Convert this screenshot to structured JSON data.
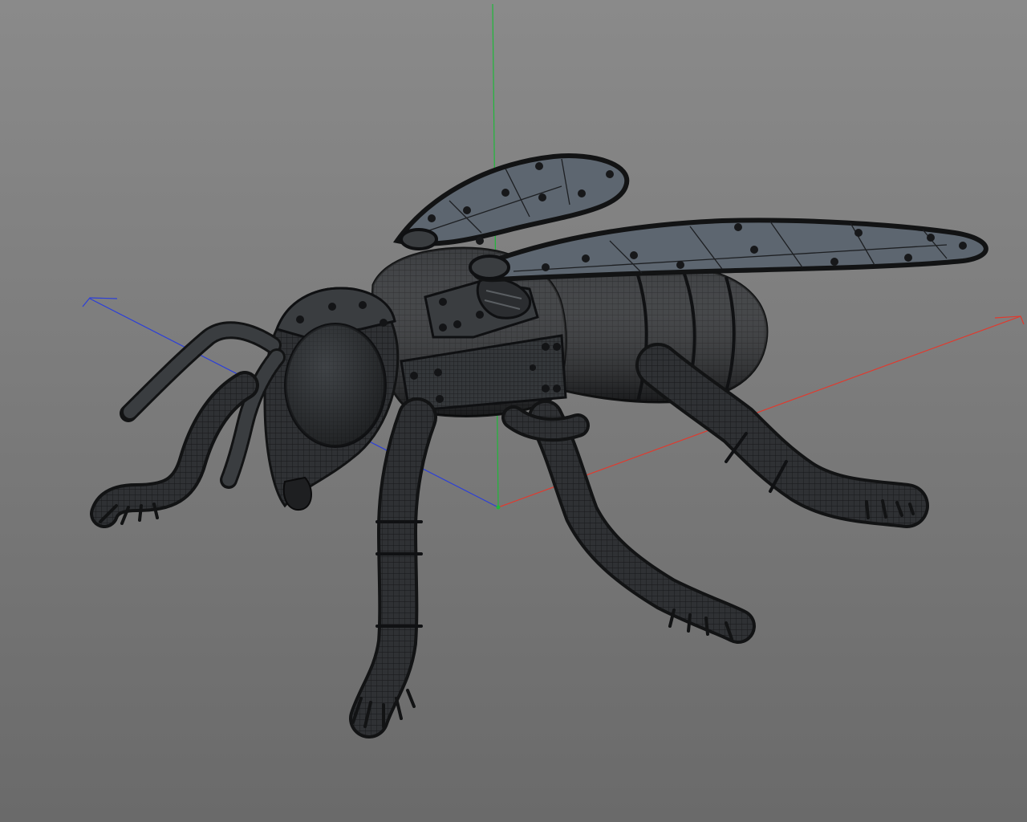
{
  "viewport": {
    "name": "3d-perspective-viewport",
    "background_top": "#8a8a8a",
    "background_bottom": "#6a6a6a"
  },
  "axes": {
    "x_color": "#e03a2e",
    "y_color": "#1fb83a",
    "z_color": "#2c3fd8"
  },
  "model": {
    "object": "bee-polygon-mesh",
    "display": "wireframe-on-shaded",
    "mesh_color": "#2f3134",
    "wire_color": "#121314",
    "wing_color": "#5d6670"
  }
}
